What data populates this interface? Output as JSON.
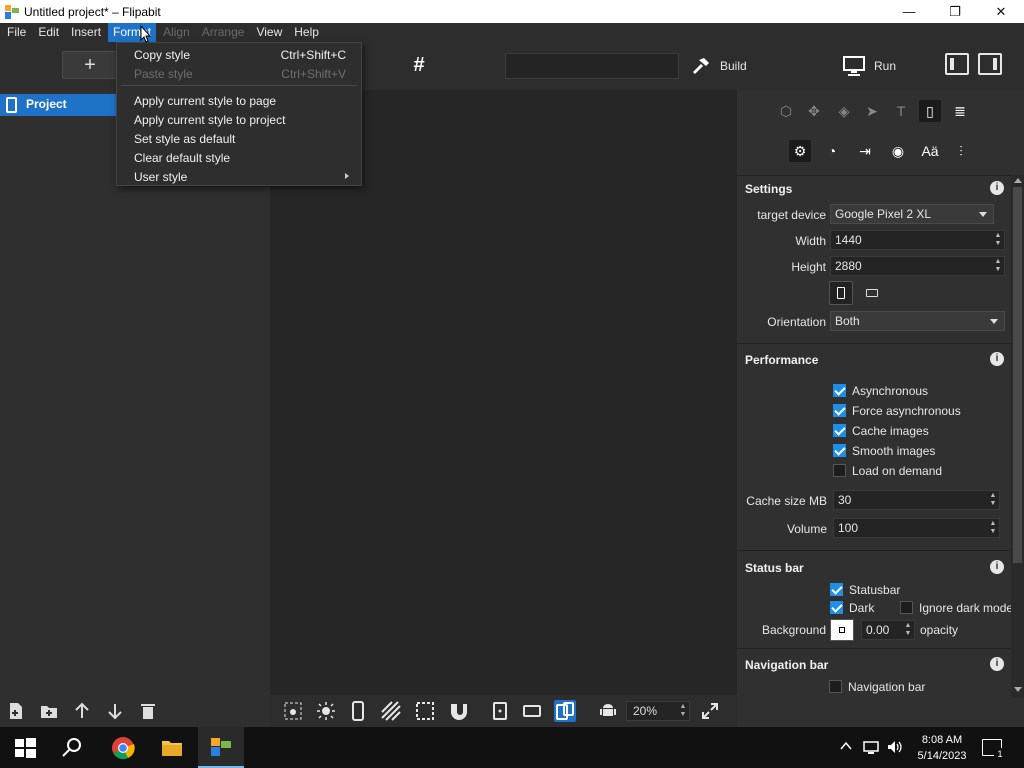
{
  "window": {
    "title": "Untitled project* – Flipabit",
    "minimize": "—",
    "restore": "❐",
    "close": "✕"
  },
  "menubar": {
    "items": [
      {
        "label": "File",
        "state": "normal"
      },
      {
        "label": "Edit",
        "state": "normal"
      },
      {
        "label": "Insert",
        "state": "normal"
      },
      {
        "label": "Format",
        "state": "active"
      },
      {
        "label": "Align",
        "state": "disabled"
      },
      {
        "label": "Arrange",
        "state": "disabled"
      },
      {
        "label": "View",
        "state": "normal"
      },
      {
        "label": "Help",
        "state": "normal"
      }
    ]
  },
  "toolbar": {
    "add": "+",
    "hash": "#",
    "build_label": "Build",
    "run_label": "Run"
  },
  "format_menu": {
    "items": [
      {
        "label": "Copy style",
        "shortcut": "Ctrl+Shift+C",
        "disabled": false
      },
      {
        "label": "Paste style",
        "shortcut": "Ctrl+Shift+V",
        "disabled": true
      },
      {
        "label": "Apply current style to page",
        "shortcut": "",
        "disabled": false
      },
      {
        "label": "Apply current style to project",
        "shortcut": "",
        "disabled": false
      },
      {
        "label": "Set style as default",
        "shortcut": "",
        "disabled": false
      },
      {
        "label": "Clear default style",
        "shortcut": "",
        "disabled": false
      },
      {
        "label": "User style",
        "shortcut": "",
        "disabled": false,
        "submenu": true
      }
    ]
  },
  "left_panel": {
    "project_label": "Project"
  },
  "canvas_toolbar": {
    "zoom": "20%"
  },
  "settings": {
    "title": "Settings",
    "target_device_label": "target device",
    "target_device_value": "Google Pixel 2 XL",
    "width_label": "Width",
    "width_value": "1440",
    "height_label": "Height",
    "height_value": "2880",
    "orientation_label": "Orientation",
    "orientation_value": "Both"
  },
  "performance": {
    "title": "Performance",
    "options": [
      {
        "label": "Asynchronous",
        "checked": true
      },
      {
        "label": "Force asynchronous",
        "checked": true
      },
      {
        "label": "Cache images",
        "checked": true
      },
      {
        "label": "Smooth images",
        "checked": true
      },
      {
        "label": "Load on demand",
        "checked": false
      }
    ],
    "cache_label": "Cache size MB",
    "cache_value": "30",
    "volume_label": "Volume",
    "volume_value": "100"
  },
  "status_bar": {
    "title": "Status bar",
    "statusbar_label": "Statusbar",
    "dark_label": "Dark",
    "ignore_dark_label": "Ignore dark mode",
    "background_label": "Background",
    "opacity_value": "0.00",
    "opacity_label": "opacity"
  },
  "navigation_bar": {
    "title": "Navigation bar",
    "checkbox_label": "Navigation bar"
  },
  "taskbar": {
    "time": "8:08 AM",
    "date": "5/14/2023",
    "notifications": "1"
  },
  "colors": {
    "accent": "#1e73c8",
    "checkbox": "#1e8fe6"
  }
}
